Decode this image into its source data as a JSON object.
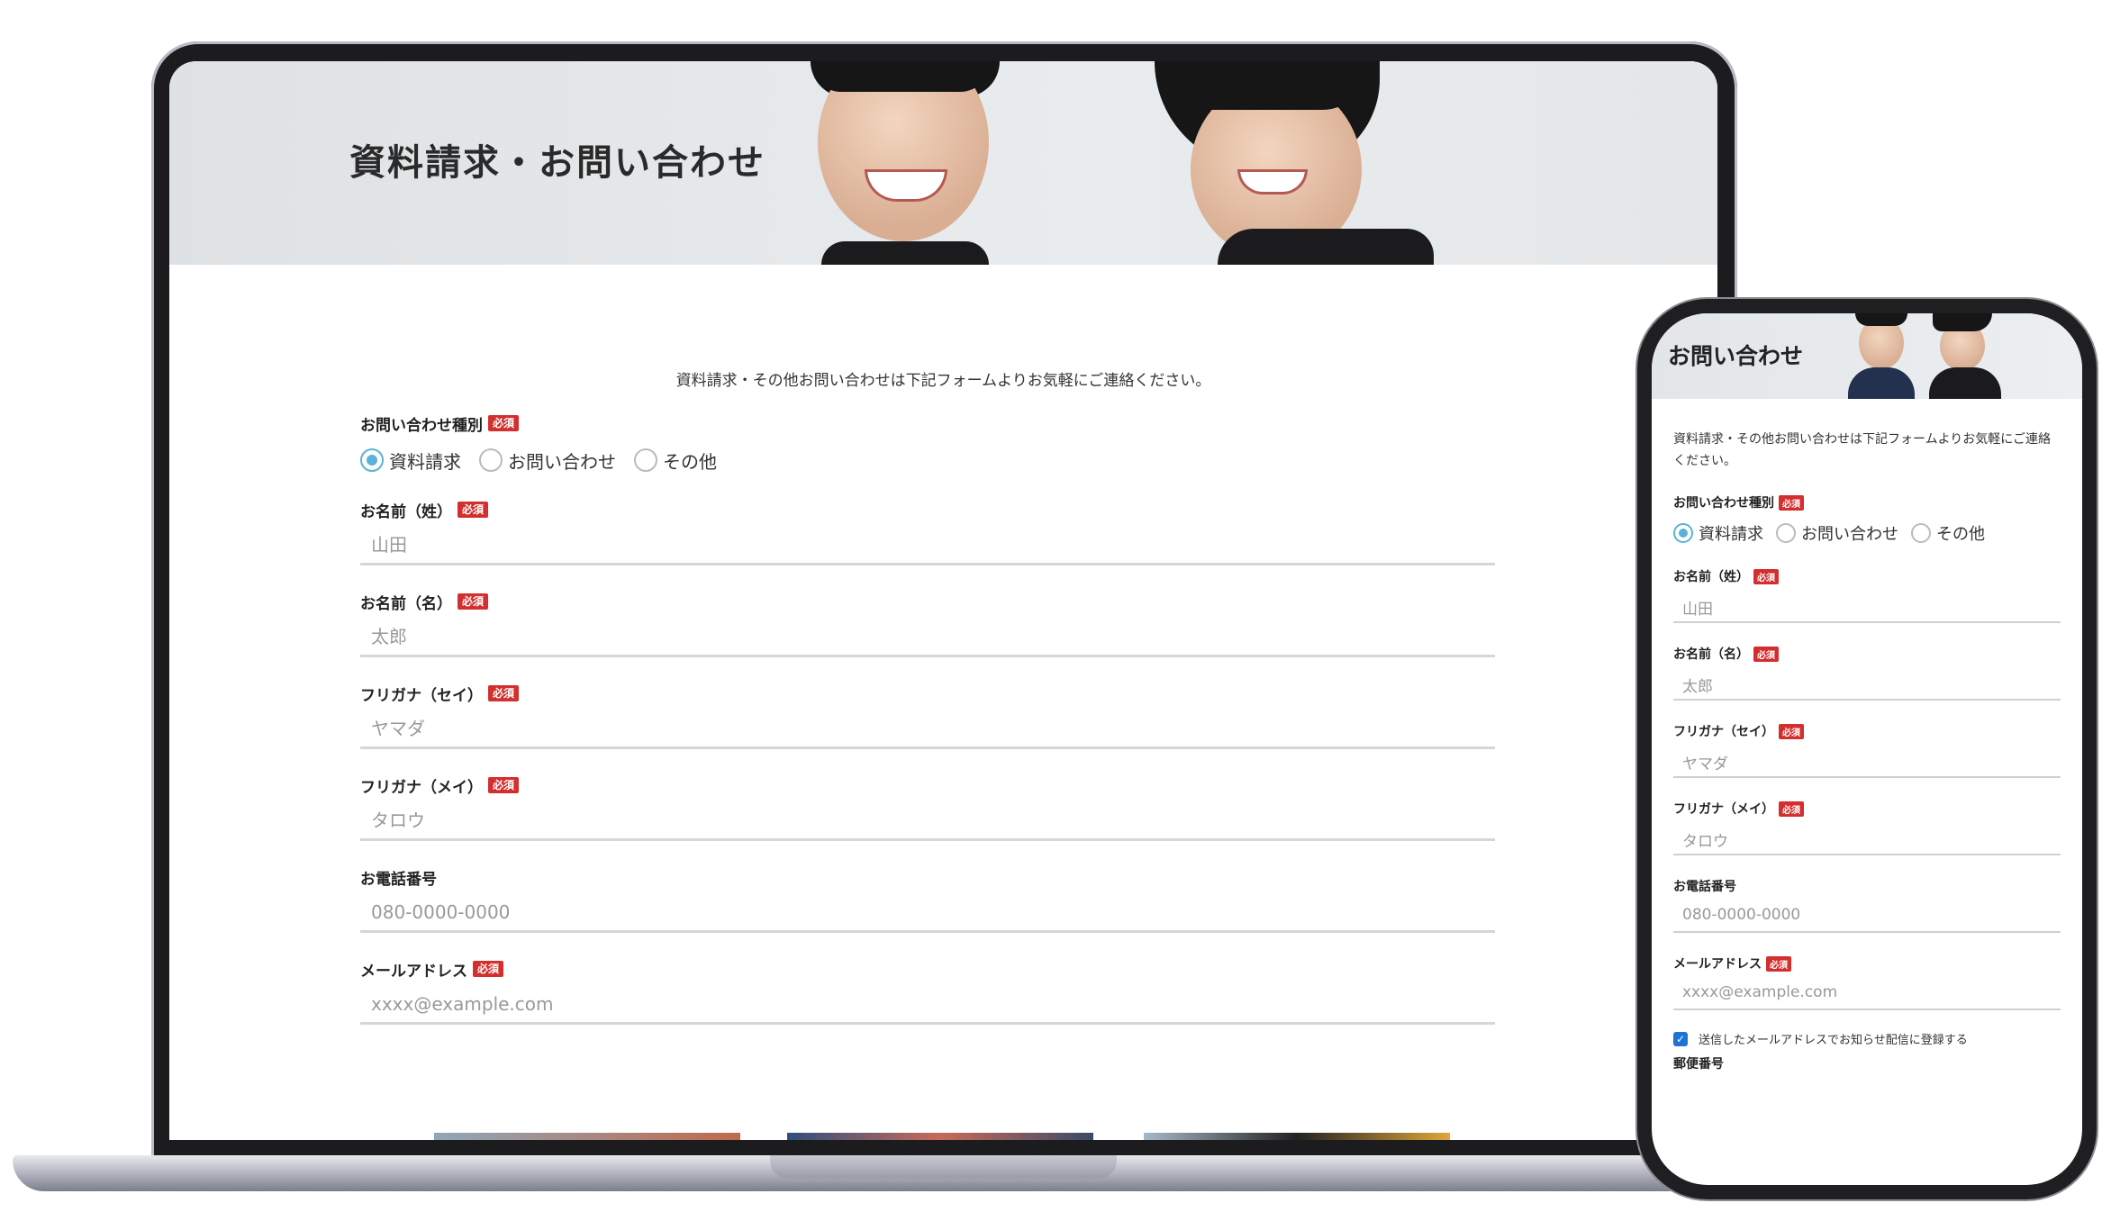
{
  "desktop": {
    "hero_title": "資料請求・お問い合わせ",
    "intro": "資料請求・その他お問い合わせは下記フォームよりお気軽にご連絡ください。",
    "required_label": "必須",
    "inquiry_type": {
      "label": "お問い合わせ種別",
      "options": [
        "資料請求",
        "お問い合わせ",
        "その他"
      ],
      "selected": "資料請求"
    },
    "fields": [
      {
        "label": "お名前（姓）",
        "placeholder": "山田",
        "required": true
      },
      {
        "label": "お名前（名）",
        "placeholder": "太郎",
        "required": true
      },
      {
        "label": "フリガナ（セイ）",
        "placeholder": "ヤマダ",
        "required": true
      },
      {
        "label": "フリガナ（メイ）",
        "placeholder": "タロウ",
        "required": true
      },
      {
        "label": "お電話番号",
        "placeholder": "080-0000-0000",
        "required": false
      },
      {
        "label": "メールアドレス",
        "placeholder": "xxxx@example.com",
        "required": true
      }
    ]
  },
  "mobile": {
    "hero_title": "お問い合わせ",
    "intro": "資料請求・その他お問い合わせは下記フォームよりお気軽にご連絡ください。",
    "required_label": "必須",
    "inquiry_type": {
      "label": "お問い合わせ種別",
      "options": [
        "資料請求",
        "お問い合わせ",
        "その他"
      ],
      "selected": "資料請求"
    },
    "fields": [
      {
        "label": "お名前（姓）",
        "placeholder": "山田",
        "required": true
      },
      {
        "label": "お名前（名）",
        "placeholder": "太郎",
        "required": true
      },
      {
        "label": "フリガナ（セイ）",
        "placeholder": "ヤマダ",
        "required": true
      },
      {
        "label": "フリガナ（メイ）",
        "placeholder": "タロウ",
        "required": true
      },
      {
        "label": "お電話番号",
        "placeholder": "080-0000-0000",
        "required": false
      },
      {
        "label": "メールアドレス",
        "placeholder": "xxxx@example.com",
        "required": true
      }
    ],
    "newsletter_checkbox": "送信したメールアドレスでお知らせ配信に登録する",
    "newsletter_checked": true,
    "postal_label": "郵便番号"
  },
  "colors": {
    "required_badge": "#d32f2f",
    "radio_accent": "#5bb2d8",
    "checkbox_accent": "#1e73d6"
  }
}
